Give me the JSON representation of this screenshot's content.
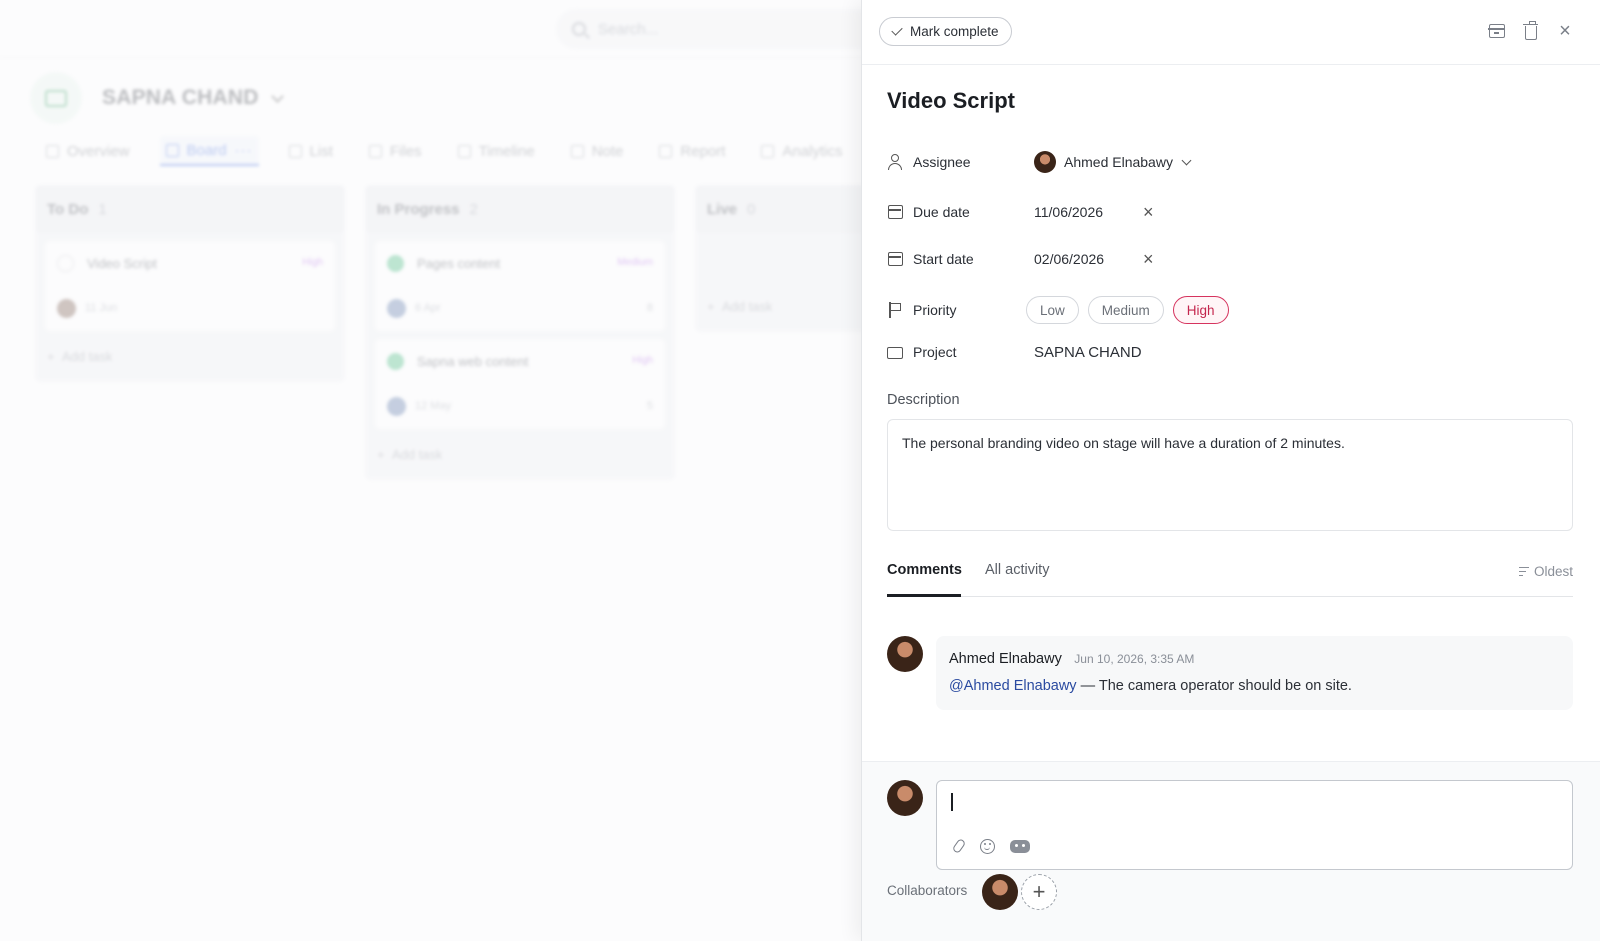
{
  "background": {
    "search_placeholder": "Search...",
    "project_name": "SAPNA CHAND",
    "view_tabs": [
      "Overview",
      "Board",
      "List",
      "Files",
      "Timeline",
      "Note",
      "Report",
      "Analytics"
    ],
    "columns": [
      {
        "name": "To Do",
        "count": "1",
        "cards": [
          {
            "title": "Video Script",
            "priority": "High",
            "date": "11 Jun",
            "comments": ""
          }
        ]
      },
      {
        "name": "In Progress",
        "count": "2",
        "cards": [
          {
            "title": "Pages content",
            "priority": "Medium",
            "date": "6 Apr",
            "comments": "8"
          },
          {
            "title": "Sapna web content",
            "priority": "High",
            "date": "12 May",
            "comments": "5"
          }
        ]
      },
      {
        "name": "Live",
        "count": "0",
        "cards": []
      }
    ],
    "add_task_label": "Add task"
  },
  "drawer": {
    "mark_complete_label": "Mark complete",
    "title": "Video Script",
    "fields": {
      "assignee_label": "Assignee",
      "assignee_value": "Ahmed Elnabawy",
      "due_label": "Due date",
      "due_value": "11/06/2026",
      "start_label": "Start date",
      "start_value": "02/06/2026",
      "priority_label": "Priority",
      "priority_options": [
        "Low",
        "Medium",
        "High"
      ],
      "priority_selected": "High",
      "project_label": "Project",
      "project_value": "SAPNA CHAND"
    },
    "description_label": "Description",
    "description_text": "The personal branding video on stage will have a duration of 2 minutes.",
    "tabs": {
      "comments": "Comments",
      "activity": "All activity",
      "sort": "Oldest"
    },
    "comment": {
      "author": "Ahmed Elnabawy",
      "time": "Jun 10, 2026, 3:35 AM",
      "mention": "@Ahmed Elnabawy",
      "body": " — The camera operator should be on site."
    },
    "collaborators_label": "Collaborators",
    "add_collaborator_symbol": "+",
    "close_symbol": "×"
  },
  "colors": {
    "accent": "#2a5bd7",
    "priority_high": "#d6335e",
    "done_green": "#2fb36f",
    "mention": "#2a4aa0"
  }
}
